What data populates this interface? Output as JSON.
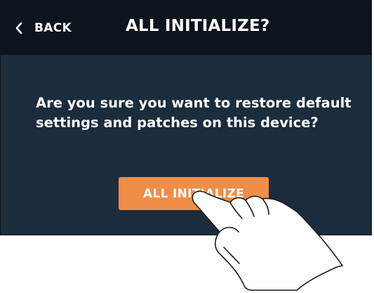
{
  "header": {
    "back_label": "BACK",
    "back_icon": "chevron-left-icon",
    "title": "ALL INITIALIZE?"
  },
  "dialog": {
    "message_line1": "Are you sure you want to restore default",
    "message_line2": "settings and patches on this device?",
    "confirm_label": "ALL INITIALIZE"
  },
  "overlay": {
    "icon": "pointing-hand-icon"
  },
  "colors": {
    "screen_background": "#1b2c3c",
    "header_background": "#0c141d",
    "accent_button": "#f08d47",
    "text": "#ffffff"
  }
}
